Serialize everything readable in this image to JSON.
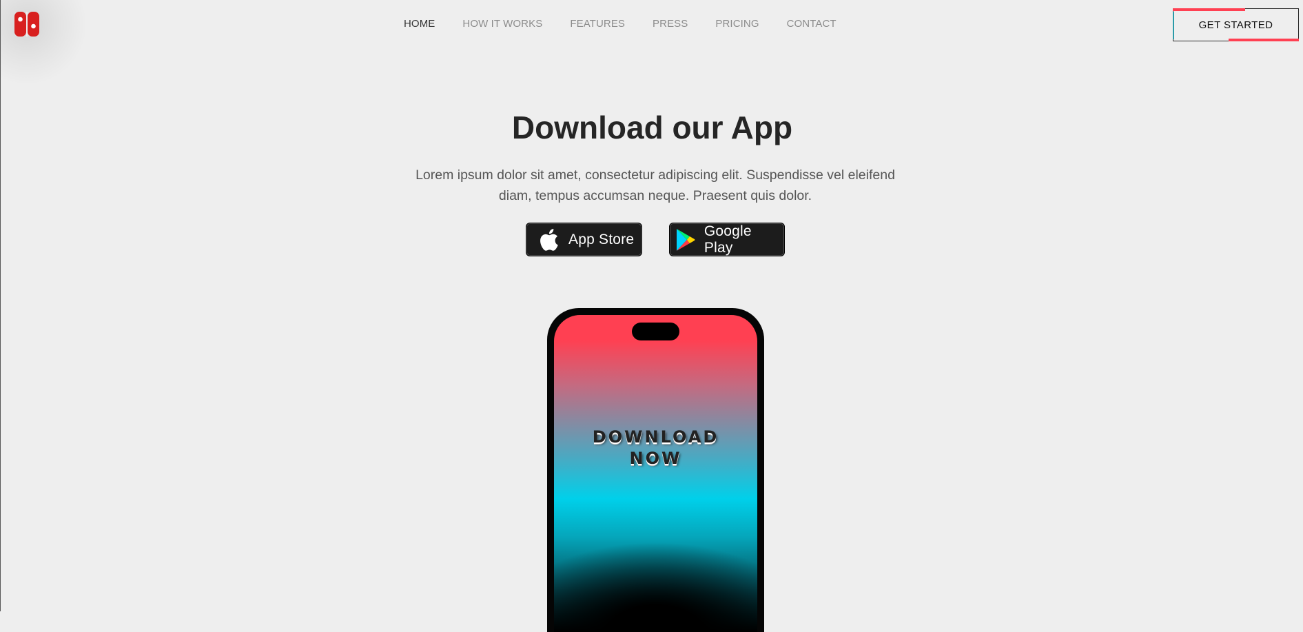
{
  "brand": {
    "logo": "console-joycon-logo",
    "accent": "#ff4052"
  },
  "nav": {
    "items": [
      {
        "label": "HOME",
        "active": true
      },
      {
        "label": "HOW IT WORKS",
        "active": false
      },
      {
        "label": "FEATURES",
        "active": false
      },
      {
        "label": "PRESS",
        "active": false
      },
      {
        "label": "PRICING",
        "active": false
      },
      {
        "label": "CONTACT",
        "active": false
      }
    ]
  },
  "header": {
    "cta_label": "GET STARTED"
  },
  "hero": {
    "title": "Download our App",
    "lead": "Lorem ipsum dolor sit amet, consectetur adipiscing elit. Suspendisse vel eleifend diam, tempus accumsan neque. Praesent quis dolor."
  },
  "stores": {
    "apple": {
      "label": "App Store",
      "icon": "apple-icon"
    },
    "google": {
      "label": "Google Play",
      "icon": "google-play-icon"
    }
  },
  "phone": {
    "screen_line1": "DOWNLOAD",
    "screen_line2": "NOW"
  }
}
